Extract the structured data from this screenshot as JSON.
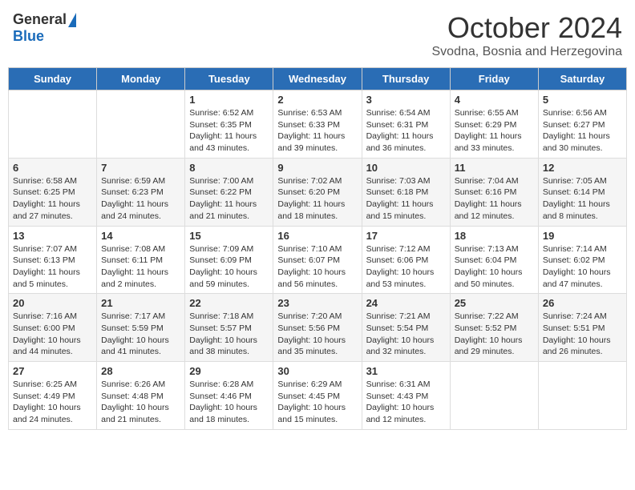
{
  "header": {
    "logo_general": "General",
    "logo_blue": "Blue",
    "month": "October 2024",
    "location": "Svodna, Bosnia and Herzegovina"
  },
  "days_of_week": [
    "Sunday",
    "Monday",
    "Tuesday",
    "Wednesday",
    "Thursday",
    "Friday",
    "Saturday"
  ],
  "weeks": [
    [
      {
        "day": "",
        "info": ""
      },
      {
        "day": "",
        "info": ""
      },
      {
        "day": "1",
        "info": "Sunrise: 6:52 AM\nSunset: 6:35 PM\nDaylight: 11 hours and 43 minutes."
      },
      {
        "day": "2",
        "info": "Sunrise: 6:53 AM\nSunset: 6:33 PM\nDaylight: 11 hours and 39 minutes."
      },
      {
        "day": "3",
        "info": "Sunrise: 6:54 AM\nSunset: 6:31 PM\nDaylight: 11 hours and 36 minutes."
      },
      {
        "day": "4",
        "info": "Sunrise: 6:55 AM\nSunset: 6:29 PM\nDaylight: 11 hours and 33 minutes."
      },
      {
        "day": "5",
        "info": "Sunrise: 6:56 AM\nSunset: 6:27 PM\nDaylight: 11 hours and 30 minutes."
      }
    ],
    [
      {
        "day": "6",
        "info": "Sunrise: 6:58 AM\nSunset: 6:25 PM\nDaylight: 11 hours and 27 minutes."
      },
      {
        "day": "7",
        "info": "Sunrise: 6:59 AM\nSunset: 6:23 PM\nDaylight: 11 hours and 24 minutes."
      },
      {
        "day": "8",
        "info": "Sunrise: 7:00 AM\nSunset: 6:22 PM\nDaylight: 11 hours and 21 minutes."
      },
      {
        "day": "9",
        "info": "Sunrise: 7:02 AM\nSunset: 6:20 PM\nDaylight: 11 hours and 18 minutes."
      },
      {
        "day": "10",
        "info": "Sunrise: 7:03 AM\nSunset: 6:18 PM\nDaylight: 11 hours and 15 minutes."
      },
      {
        "day": "11",
        "info": "Sunrise: 7:04 AM\nSunset: 6:16 PM\nDaylight: 11 hours and 12 minutes."
      },
      {
        "day": "12",
        "info": "Sunrise: 7:05 AM\nSunset: 6:14 PM\nDaylight: 11 hours and 8 minutes."
      }
    ],
    [
      {
        "day": "13",
        "info": "Sunrise: 7:07 AM\nSunset: 6:13 PM\nDaylight: 11 hours and 5 minutes."
      },
      {
        "day": "14",
        "info": "Sunrise: 7:08 AM\nSunset: 6:11 PM\nDaylight: 11 hours and 2 minutes."
      },
      {
        "day": "15",
        "info": "Sunrise: 7:09 AM\nSunset: 6:09 PM\nDaylight: 10 hours and 59 minutes."
      },
      {
        "day": "16",
        "info": "Sunrise: 7:10 AM\nSunset: 6:07 PM\nDaylight: 10 hours and 56 minutes."
      },
      {
        "day": "17",
        "info": "Sunrise: 7:12 AM\nSunset: 6:06 PM\nDaylight: 10 hours and 53 minutes."
      },
      {
        "day": "18",
        "info": "Sunrise: 7:13 AM\nSunset: 6:04 PM\nDaylight: 10 hours and 50 minutes."
      },
      {
        "day": "19",
        "info": "Sunrise: 7:14 AM\nSunset: 6:02 PM\nDaylight: 10 hours and 47 minutes."
      }
    ],
    [
      {
        "day": "20",
        "info": "Sunrise: 7:16 AM\nSunset: 6:00 PM\nDaylight: 10 hours and 44 minutes."
      },
      {
        "day": "21",
        "info": "Sunrise: 7:17 AM\nSunset: 5:59 PM\nDaylight: 10 hours and 41 minutes."
      },
      {
        "day": "22",
        "info": "Sunrise: 7:18 AM\nSunset: 5:57 PM\nDaylight: 10 hours and 38 minutes."
      },
      {
        "day": "23",
        "info": "Sunrise: 7:20 AM\nSunset: 5:56 PM\nDaylight: 10 hours and 35 minutes."
      },
      {
        "day": "24",
        "info": "Sunrise: 7:21 AM\nSunset: 5:54 PM\nDaylight: 10 hours and 32 minutes."
      },
      {
        "day": "25",
        "info": "Sunrise: 7:22 AM\nSunset: 5:52 PM\nDaylight: 10 hours and 29 minutes."
      },
      {
        "day": "26",
        "info": "Sunrise: 7:24 AM\nSunset: 5:51 PM\nDaylight: 10 hours and 26 minutes."
      }
    ],
    [
      {
        "day": "27",
        "info": "Sunrise: 6:25 AM\nSunset: 4:49 PM\nDaylight: 10 hours and 24 minutes."
      },
      {
        "day": "28",
        "info": "Sunrise: 6:26 AM\nSunset: 4:48 PM\nDaylight: 10 hours and 21 minutes."
      },
      {
        "day": "29",
        "info": "Sunrise: 6:28 AM\nSunset: 4:46 PM\nDaylight: 10 hours and 18 minutes."
      },
      {
        "day": "30",
        "info": "Sunrise: 6:29 AM\nSunset: 4:45 PM\nDaylight: 10 hours and 15 minutes."
      },
      {
        "day": "31",
        "info": "Sunrise: 6:31 AM\nSunset: 4:43 PM\nDaylight: 10 hours and 12 minutes."
      },
      {
        "day": "",
        "info": ""
      },
      {
        "day": "",
        "info": ""
      }
    ]
  ]
}
